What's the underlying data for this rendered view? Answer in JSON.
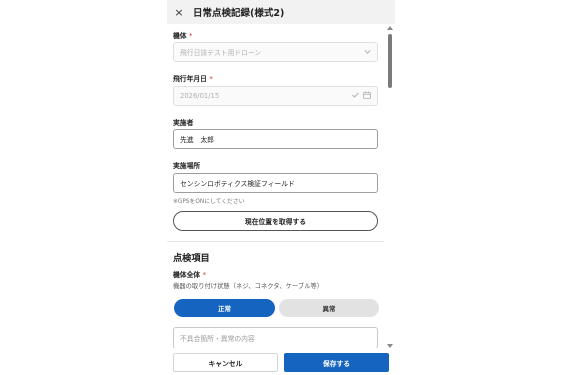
{
  "header": {
    "close_icon": "×",
    "title": "日常点検記録(様式2)"
  },
  "form": {
    "airframe": {
      "label": "機体",
      "required_mark": "*",
      "value": "飛行日誌テスト用ドローン",
      "trail_icon": "chevron-down-icon"
    },
    "flight_date": {
      "label": "飛行年月日",
      "required_mark": "*",
      "value": "2026/01/15",
      "trail_icons": [
        "check-icon",
        "calendar-icon"
      ]
    },
    "operator": {
      "label": "実施者",
      "value": "先進　太郎"
    },
    "location": {
      "label": "実施場所",
      "value": "センシンロボティクス検証フィールド",
      "hint": "※GPSをONにしてください",
      "get_location_label": "現在位置を取得する"
    }
  },
  "inspection": {
    "section_title": "点検項目",
    "item": {
      "label": "機体全体",
      "required_mark": "*",
      "description": "機器の取り付け状態（ネジ、コネクタ、ケーブル等）",
      "option_normal": "正常",
      "option_abnormal": "異常",
      "selected": "正常",
      "defect_placeholder": "不具合箇所・異常の内容"
    }
  },
  "footer": {
    "cancel_label": "キャンセル",
    "save_label": "保存する"
  },
  "colors": {
    "accent": "#1565c0",
    "required": "#d32f2f"
  }
}
